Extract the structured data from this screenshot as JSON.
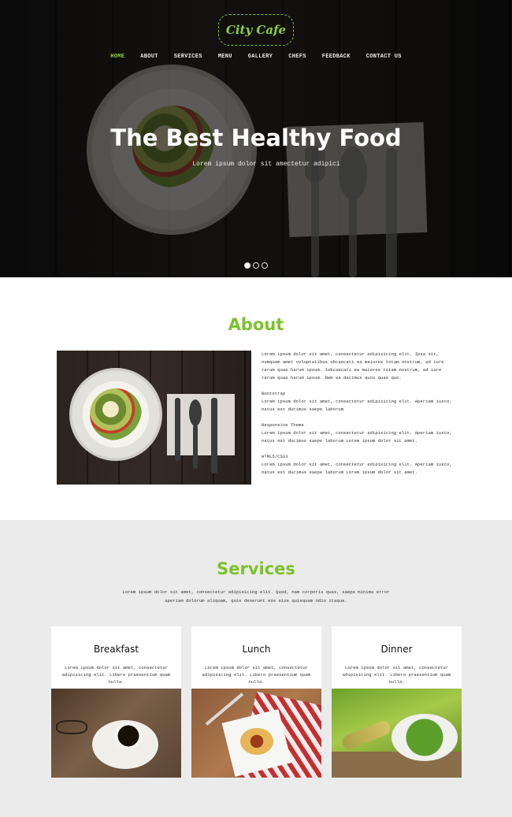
{
  "brand": {
    "logo_text": "City Cafe",
    "accent_color": "#7cc12b"
  },
  "nav": {
    "items": [
      {
        "label": "HOME",
        "active": true
      },
      {
        "label": "ABOUT"
      },
      {
        "label": "SERVICES"
      },
      {
        "label": "MENU"
      },
      {
        "label": "GALLERY"
      },
      {
        "label": "CHEFS"
      },
      {
        "label": "FEEDBACK"
      },
      {
        "label": "CONTACT US"
      }
    ]
  },
  "hero": {
    "title": "The Best Healthy Food",
    "subtitle": "Lorem ipsum dolor sit amectetur adipici",
    "slides_count": 3,
    "active_slide": 1
  },
  "about": {
    "title": "About",
    "intro": "Lorem ipsum dolor sit amet, consectetur adipisicing elit. Ipsa sit, numquam amet voluptatibus obcaecati ea maiores totam nostrum, ad iure rerum quae harum ipsum. Iobcaecati ea maiores totam nostrum, ad iure rerum quae harum ipsum. Rem ea dacimus quos quae quo.",
    "features": [
      {
        "heading": "Bootstrap",
        "text": "Lorem ipsum dolor sit amet, consectetur adipisicing elit. Aperiam iusto, natus est ducimus saepe laborum"
      },
      {
        "heading": "Responsive Theme",
        "text": "Lorem ipsum dolor sit amet, consectetur adipisicing elit. Aperiam iusto, natus est ducimus saepe laborum Lorem ipsum dolor sit amet."
      },
      {
        "heading": "HTML5/CSS3",
        "text": "Lorem ipsum dolor sit amet, consectetur adipisicing elit. Aperiam iusto, natus est ducimus saepe laborum Lorem ipsum dolor sit amet."
      }
    ]
  },
  "services": {
    "title": "Services",
    "intro": "Lorem ipsum dolor sit amet, consectetur adipisicing elit. Quod, nam corporis quas, saepe minima error aperiam dolorum aliquam, quis deserunt eos eius quisquam odio itaque.",
    "cards": [
      {
        "title": "Breakfast",
        "text": "Lorem ipsum dolor sit amet, consectetur adipisicing elit. Libero praesentium quam nulla."
      },
      {
        "title": "Lunch",
        "text": "Lorem ipsum dolor sit amet, consectetur adipisicing elit. Libero praesentium quam nulla."
      },
      {
        "title": "Dinner",
        "text": "Lorem ipsum dolor sit amet, consectetur adipisicing elit. Libero praesentium quam nulla."
      }
    ]
  }
}
